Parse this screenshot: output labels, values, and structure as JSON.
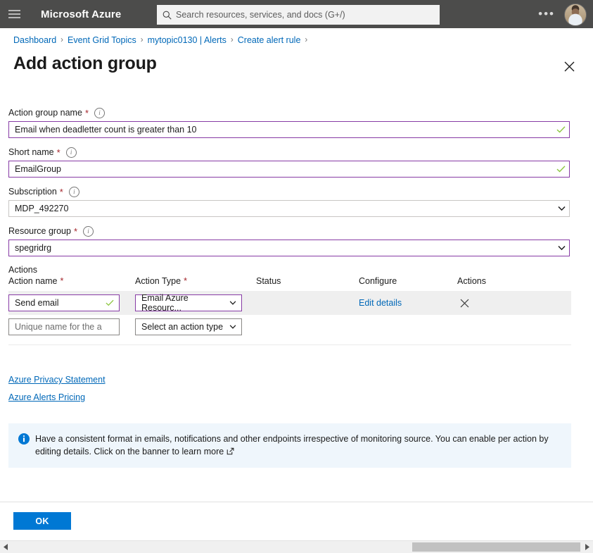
{
  "topbar": {
    "menu_icon": "hamburger-icon",
    "brand": "Microsoft Azure",
    "search_placeholder": "Search resources, services, and docs (G+/)",
    "search_value": "",
    "search_icon": "search-icon",
    "more_icon": "ellipsis-icon",
    "avatar_icon": "user-avatar"
  },
  "breadcrumb": {
    "items": [
      {
        "label": "Dashboard"
      },
      {
        "label": "Event Grid Topics"
      },
      {
        "label": "mytopic0130 | Alerts"
      },
      {
        "label": "Create alert rule"
      }
    ],
    "separator": "›"
  },
  "blade": {
    "title": "Add action group",
    "close_icon": "close-icon"
  },
  "form": {
    "info_icon": "info-icon",
    "required_mark": "*",
    "fields": [
      {
        "label": "Action group name",
        "value": "Email when deadletter count is greater than 10",
        "placeholder": "",
        "state": "valid",
        "control": "textbox",
        "validation_icon": "checkmark-icon"
      },
      {
        "label": "Short name",
        "value": "EmailGroup",
        "placeholder": "",
        "state": "valid",
        "control": "textbox",
        "validation_icon": "checkmark-icon"
      },
      {
        "label": "Subscription",
        "value": "MDP_492270",
        "placeholder": "",
        "state": "default",
        "control": "dropdown",
        "chevron_icon": "chevron-down-icon"
      },
      {
        "label": "Resource group",
        "value": "spegridrg",
        "placeholder": "",
        "state": "valid",
        "control": "dropdown",
        "chevron_icon": "chevron-down-icon"
      }
    ]
  },
  "actions": {
    "caption": "Actions",
    "columns": [
      {
        "label": "Action name",
        "required": true
      },
      {
        "label": "Action Type",
        "required": true
      },
      {
        "label": "Status",
        "required": false
      },
      {
        "label": "Configure",
        "required": false
      },
      {
        "label": "Actions",
        "required": false
      }
    ],
    "rows": [
      {
        "selected": true,
        "name_value": "Send email",
        "name_placeholder": "",
        "name_state": "valid",
        "name_validation_icon": "checkmark-icon",
        "type_value": "Email Azure Resourc...",
        "type_state": "valid",
        "type_chevron_icon": "chevron-down-icon",
        "status": "",
        "configure_label": "Edit details",
        "remove_icon": "close-icon"
      },
      {
        "selected": false,
        "name_value": "",
        "name_placeholder": "Unique name for the ac...",
        "name_state": "default",
        "type_value": "Select an action type",
        "type_state": "default",
        "type_chevron_icon": "chevron-down-icon",
        "status": "",
        "configure_label": "",
        "remove_icon": ""
      }
    ]
  },
  "links": [
    {
      "label": "Azure Privacy Statement"
    },
    {
      "label": "Azure Alerts Pricing"
    }
  ],
  "banner": {
    "icon": "info-filled-icon",
    "text": "Have a consistent format in emails, notifications and other endpoints irrespective of monitoring source. You can enable per action by editing details. Click on the banner to learn more",
    "external_link_icon": "external-link-icon"
  },
  "footer": {
    "ok_label": "OK"
  },
  "scrollbar": {
    "left_arrow_icon": "triangle-left-icon",
    "right_arrow_icon": "triangle-right-icon"
  },
  "colors": {
    "topbar_bg": "#4c4c4b",
    "accent_blue": "#0078d4",
    "link_blue": "#0068b8",
    "validated_purple": "#873ba5",
    "required_red": "#a4262c",
    "success_green": "#8cc63f",
    "banner_bg": "#eff6fc",
    "row_selected_bg": "#efefef"
  }
}
